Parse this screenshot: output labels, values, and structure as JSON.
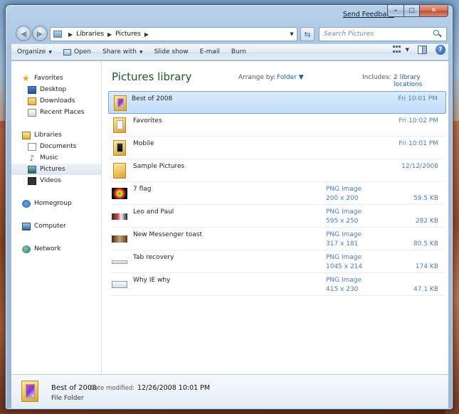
{
  "window": {
    "send_feedback": "Send Feedback",
    "caption": {
      "minimize": "–",
      "maximize": "□",
      "close": "✕"
    }
  },
  "address": {
    "crumbs": [
      "Libraries",
      "Pictures"
    ],
    "search_placeholder": "Search Pictures"
  },
  "toolbar": {
    "organize": "Organize",
    "open": "Open",
    "share_with": "Share with",
    "slide_show": "Slide show",
    "email": "E-mail",
    "burn": "Burn",
    "help": "?"
  },
  "nav": {
    "favorites": {
      "label": "Favorites",
      "items": [
        {
          "label": "Desktop",
          "icon": "desktop-icon"
        },
        {
          "label": "Downloads",
          "icon": "downloads-icon"
        },
        {
          "label": "Recent Places",
          "icon": "recent-places-icon"
        }
      ]
    },
    "libraries": {
      "label": "Libraries",
      "items": [
        {
          "label": "Documents",
          "icon": "documents-icon"
        },
        {
          "label": "Music",
          "icon": "music-icon"
        },
        {
          "label": "Pictures",
          "icon": "pictures-icon",
          "selected": true
        },
        {
          "label": "Videos",
          "icon": "videos-icon"
        }
      ]
    },
    "homegroup": "Homegroup",
    "computer": "Computer",
    "network": "Network"
  },
  "library": {
    "title": "Pictures library",
    "arrange_by_label": "Arrange by:",
    "arrange_by_value": "Folder",
    "includes_label": "Includes:",
    "includes_value": "2 library locations"
  },
  "files": [
    {
      "name": "Best of 2008",
      "kind": "folder",
      "date": "Fri 10:01 PM",
      "selected": true
    },
    {
      "name": "Favorites",
      "kind": "folder",
      "date": "Fri 10:02 PM"
    },
    {
      "name": "Mobile",
      "kind": "folder",
      "date": "Fri 10:01 PM"
    },
    {
      "name": "Sample Pictures",
      "kind": "folder",
      "date": "12/12/2008"
    },
    {
      "name": "7 flag",
      "type": "PNG Image",
      "dims": "200 x 200",
      "size": "59.5 KB"
    },
    {
      "name": "Leo and Paul",
      "type": "PNG Image",
      "dims": "595 x 250",
      "size": "282 KB"
    },
    {
      "name": "New Messenger toast",
      "type": "PNG Image",
      "dims": "317 x 181",
      "size": "80.5 KB"
    },
    {
      "name": "Tab recovery",
      "type": "PNG Image",
      "dims": "1045 x 214",
      "size": "174 KB"
    },
    {
      "name": "Why IE why",
      "type": "PNG Image",
      "dims": "415 x 230",
      "size": "47.1 KB"
    }
  ],
  "details": {
    "name": "Best of 2008",
    "modified_label": "Date modified:",
    "modified_value": "12/26/2008 10:01 PM",
    "kind": "File Folder"
  }
}
